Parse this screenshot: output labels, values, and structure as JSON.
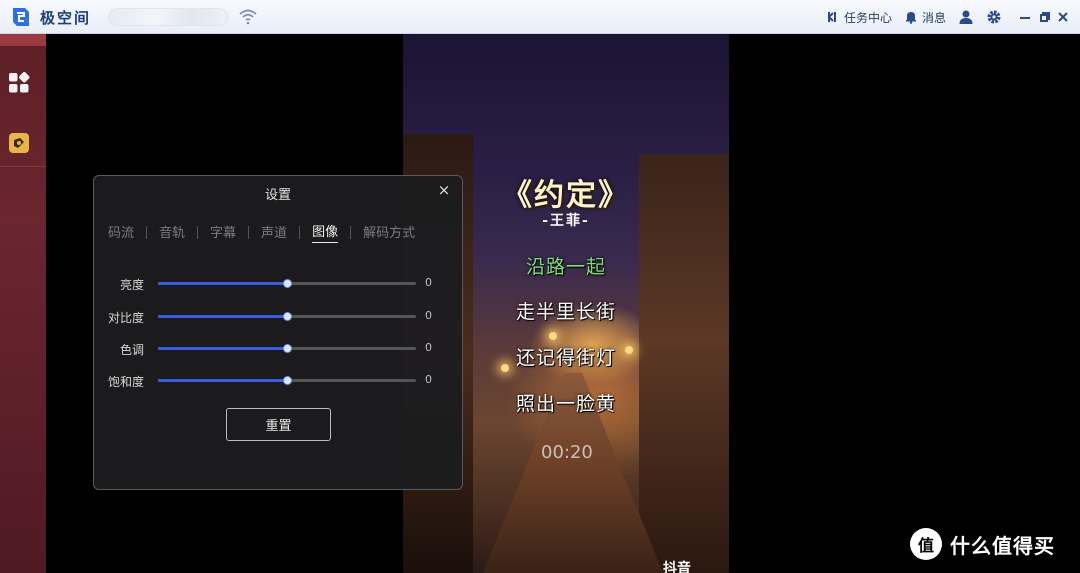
{
  "app": {
    "name": "极空间"
  },
  "toolbar": {
    "tasks_label": "任务中心",
    "messages_label": "消息"
  },
  "video": {
    "song_title": "《约定》",
    "artist": "-王菲-",
    "lyrics": [
      "沿路一起",
      "走半里长街",
      "还记得街灯",
      "照出一脸黄"
    ],
    "active_line": 0,
    "timecode": "00:20",
    "corner_text": "抖音"
  },
  "dialog": {
    "title": "设置",
    "close_symbol": "×",
    "tabs": [
      "码流",
      "音轨",
      "字幕",
      "声道",
      "图像",
      "解码方式"
    ],
    "active_tab": 4,
    "sliders": [
      {
        "label": "亮度",
        "value": "0",
        "level": 0.5
      },
      {
        "label": "对比度",
        "value": "0",
        "level": 0.5
      },
      {
        "label": "色调",
        "value": "0",
        "level": 0.5
      },
      {
        "label": "饱和度",
        "value": "0",
        "level": 0.5
      }
    ],
    "reset_label": "重置"
  },
  "watermark": {
    "text": "什么值得买",
    "logo": "值"
  },
  "colors": {
    "accent": "#3d5de0",
    "titlebar": "#eef2f9",
    "rail": "#5d1f26"
  }
}
